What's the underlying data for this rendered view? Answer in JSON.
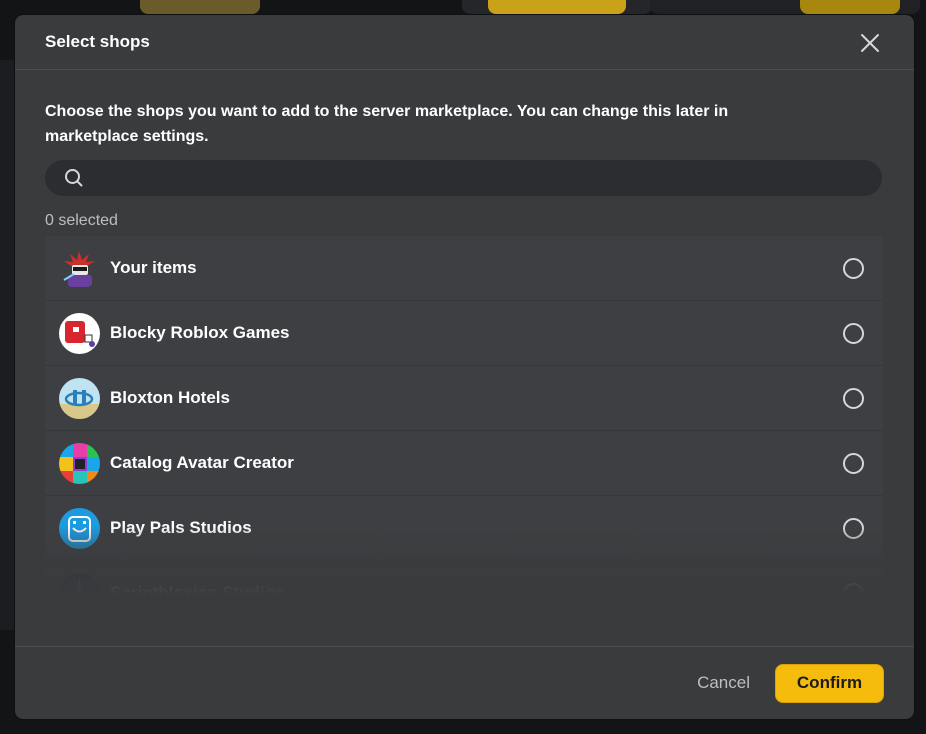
{
  "modal": {
    "title": "Select shops",
    "description": "Choose the shops you want to add to the server marketplace. You can change this later in marketplace settings.",
    "search": {
      "placeholder": "",
      "value": ""
    },
    "selected_count": "0 selected",
    "shops": [
      {
        "name": "Your items",
        "selected": false,
        "avatar_icon": "spiky-character-avatar"
      },
      {
        "name": "Blocky Roblox Games",
        "selected": false,
        "avatar_icon": "red-block-logo"
      },
      {
        "name": "Bloxton Hotels",
        "selected": false,
        "avatar_icon": "hotel-logo"
      },
      {
        "name": "Catalog Avatar Creator",
        "selected": false,
        "avatar_icon": "color-grid-logo"
      },
      {
        "name": "Play Pals Studios",
        "selected": false,
        "avatar_icon": "blue-face-logo"
      },
      {
        "name": "Scriptbloxian Studios",
        "selected": false,
        "avatar_icon": "purple-spike-logo"
      }
    ],
    "footer": {
      "cancel_label": "Cancel",
      "confirm_label": "Confirm"
    }
  },
  "colors": {
    "modal_bg": "#393b3d",
    "row_bg": "#3d3f42",
    "accent": "#f5bc0d"
  }
}
